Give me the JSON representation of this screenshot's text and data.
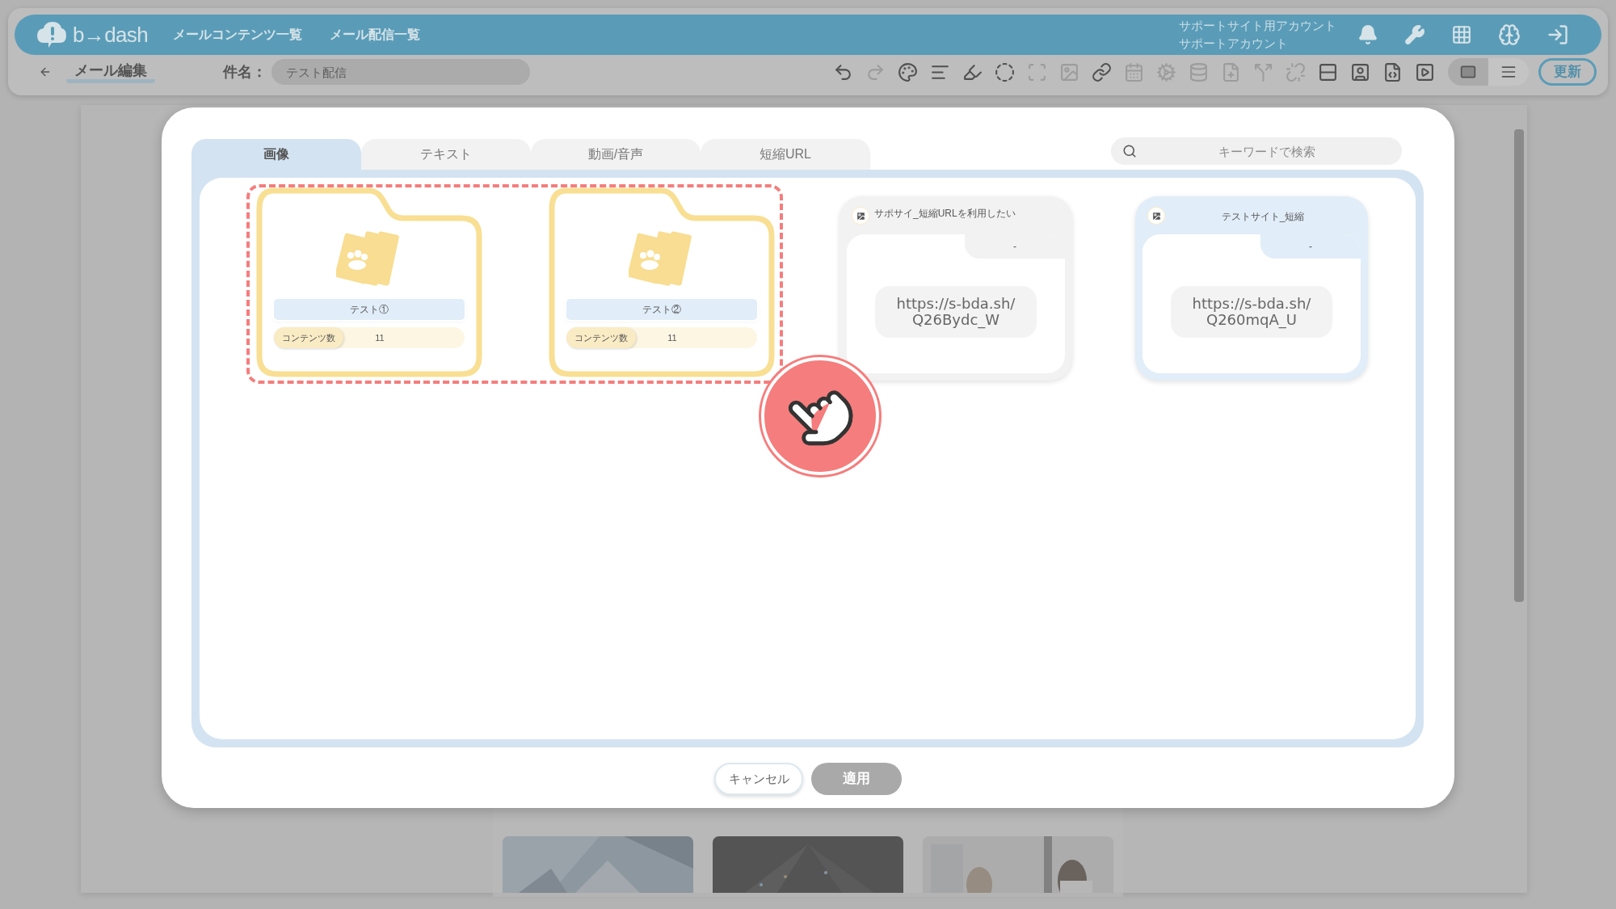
{
  "header": {
    "logo_text": "b→dash",
    "nav": [
      "メールコンテンツ一覧",
      "メール配信一覧"
    ],
    "account": [
      "サポートサイト用アカウント",
      "サポートアカウント"
    ]
  },
  "toolbar": {
    "back_label": "メール編集",
    "subject_label": "件名：",
    "subject_placeholder": "テスト配信",
    "tools": [
      {
        "disabled": false
      },
      {
        "disabled": true
      },
      {
        "disabled": false
      },
      {
        "disabled": false
      },
      {
        "disabled": false
      },
      {
        "disabled": false
      },
      {
        "disabled": true
      },
      {
        "disabled": true
      },
      {
        "disabled": false
      },
      {
        "disabled": true
      },
      {
        "disabled": true
      },
      {
        "disabled": true
      },
      {
        "disabled": true
      },
      {
        "disabled": true
      },
      {
        "disabled": true
      },
      {
        "disabled": false
      },
      {
        "disabled": false
      },
      {
        "disabled": false
      },
      {
        "disabled": false
      }
    ],
    "view_modes": [
      {
        "selected": true
      },
      {
        "selected": false
      }
    ],
    "update_button": "更新"
  },
  "modal": {
    "tabs": [
      {
        "label": "画像",
        "selected": true
      },
      {
        "label": "テキスト",
        "selected": false
      },
      {
        "label": "動画/音声",
        "selected": false
      },
      {
        "label": "短縮URL",
        "selected": false
      }
    ],
    "search": {
      "placeholder": "キーワードで検索"
    },
    "folders": [
      {
        "name": "テスト①",
        "count_label": "コンテンツ数",
        "count": "11"
      },
      {
        "name": "テスト②",
        "count_label": "コンテンツ数",
        "count": "11"
      }
    ],
    "short_urls": [
      {
        "title": "サポサイ_短縮URLを利用したい",
        "note": "-",
        "url": "https://s-bda.sh/Q26Bydc_W",
        "selected": false
      },
      {
        "title": "テストサイト_短縮",
        "note": "-",
        "url": "https://s-bda.sh/Q260mqA_U",
        "selected": true
      }
    ],
    "buttons": {
      "cancel": "キャンセル",
      "apply": "適用",
      "apply_disabled": true
    }
  }
}
